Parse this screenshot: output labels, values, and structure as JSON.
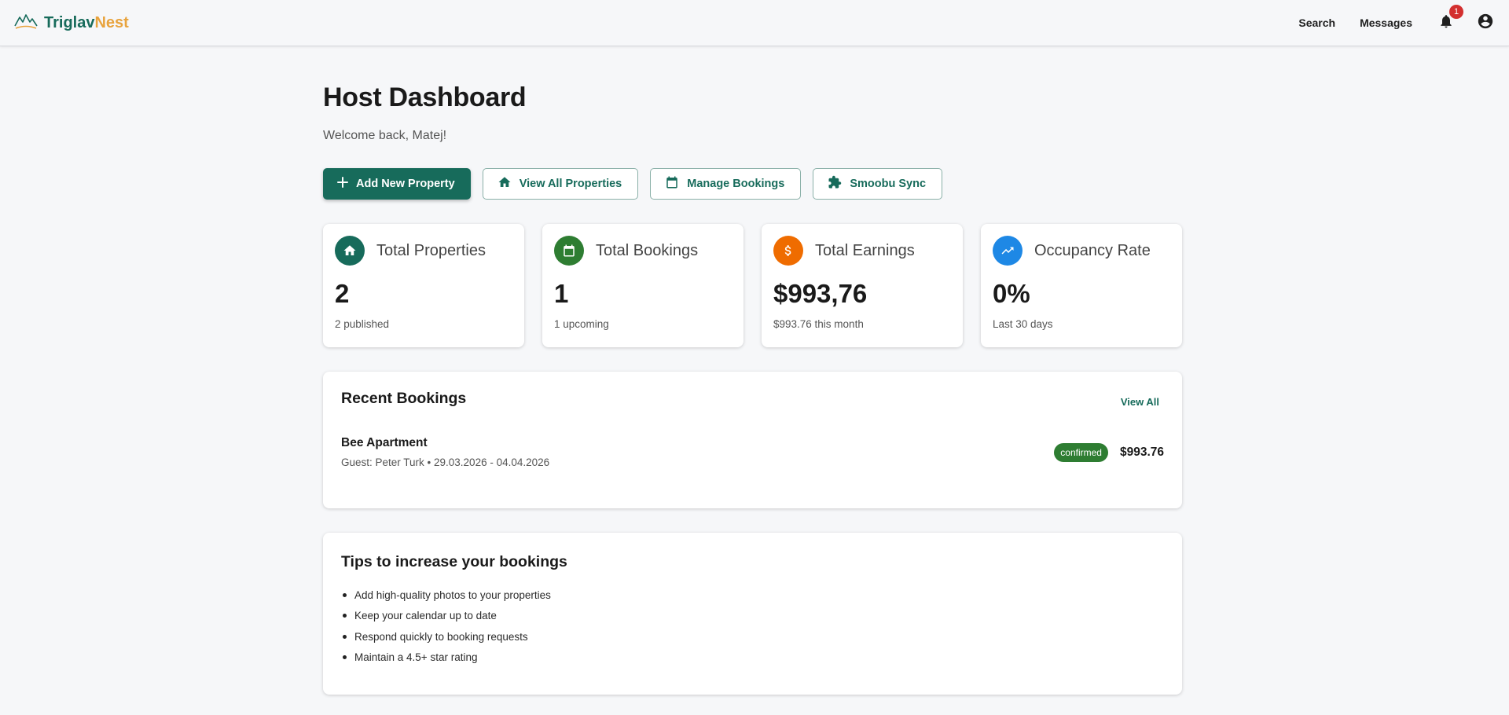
{
  "header": {
    "brand_first": "Triglav",
    "brand_second": "Nest",
    "nav": {
      "search": "Search",
      "messages": "Messages"
    },
    "notifications_count": "1",
    "logo_icon": "mountain-logo",
    "bell_icon": "bell-icon",
    "account_icon": "account-circle-icon"
  },
  "page": {
    "title": "Host Dashboard",
    "welcome": "Welcome back, Matej!"
  },
  "actions": {
    "add_property": "Add New Property",
    "view_properties": "View All Properties",
    "manage_bookings": "Manage Bookings",
    "smoobu_sync": "Smoobu Sync"
  },
  "stats": [
    {
      "label": "Total Properties",
      "value": "2",
      "sub": "2 published",
      "icon": "home-icon",
      "color": "#176b5b"
    },
    {
      "label": "Total Bookings",
      "value": "1",
      "sub": "1 upcoming",
      "icon": "calendar-icon",
      "color": "#2e7d32"
    },
    {
      "label": "Total Earnings",
      "value": "$993,76",
      "sub": "$993.76 this month",
      "icon": "dollar-icon",
      "color": "#ef6c00"
    },
    {
      "label": "Occupancy Rate",
      "value": "0%",
      "sub": "Last 30 days",
      "icon": "trending-up-icon",
      "color": "#1e88e5"
    }
  ],
  "recent": {
    "title": "Recent Bookings",
    "view_all": "View All",
    "bookings": [
      {
        "property": "Bee Apartment",
        "meta": "Guest: Peter Turk • 29.03.2026 - 04.04.2026",
        "status": "confirmed",
        "amount": "$993.76"
      }
    ]
  },
  "tips": {
    "title": "Tips to increase your bookings",
    "items": [
      "Add high-quality photos to your properties",
      "Keep your calendar up to date",
      "Respond quickly to booking requests",
      "Maintain a 4.5+ star rating"
    ]
  },
  "colors": {
    "brand": "#176b5b",
    "accent": "#e8a33d",
    "status_confirmed": "#2e7d32"
  }
}
